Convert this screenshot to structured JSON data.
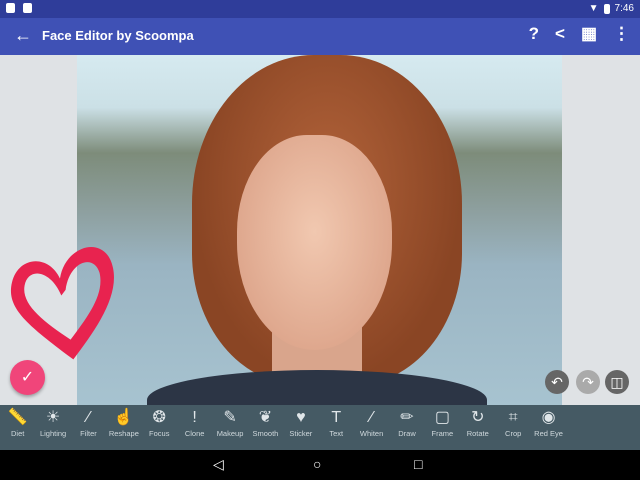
{
  "status": {
    "time": "7:46"
  },
  "appbar": {
    "title": "Face Editor by Scoompa",
    "back_icon": "arrow-left-icon",
    "actions": [
      "help-icon",
      "share-icon",
      "gift-icon",
      "more-vert-icon"
    ]
  },
  "canvas": {
    "sticker": "heart",
    "sticker_color": "#e8234f"
  },
  "controls": {
    "confirm_icon": "check-icon",
    "undo_icon": "undo-icon",
    "redo_icon": "redo-icon",
    "compare_icon": "compare-icon"
  },
  "tools": [
    {
      "label": "Diet",
      "icon": "ruler-icon",
      "glyph": "📏"
    },
    {
      "label": "Lighting",
      "icon": "sun-icon",
      "glyph": "☀"
    },
    {
      "label": "Filter",
      "icon": "magic-wand-icon",
      "glyph": "⁄"
    },
    {
      "label": "Reshape",
      "icon": "hand-icon",
      "glyph": "☝"
    },
    {
      "label": "Focus",
      "icon": "aperture-icon",
      "glyph": "❂"
    },
    {
      "label": "Clone",
      "icon": "exclamation-icon",
      "glyph": "!"
    },
    {
      "label": "Makeup",
      "icon": "lipstick-icon",
      "glyph": "✎"
    },
    {
      "label": "Smooth",
      "icon": "leaf-icon",
      "glyph": "❦"
    },
    {
      "label": "Sticker",
      "icon": "heart-icon",
      "glyph": "♥"
    },
    {
      "label": "Text",
      "icon": "text-icon",
      "glyph": "T"
    },
    {
      "label": "Whiten",
      "icon": "brush-icon",
      "glyph": "⁄"
    },
    {
      "label": "Draw",
      "icon": "pencil-icon",
      "glyph": "✏"
    },
    {
      "label": "Frame",
      "icon": "frame-icon",
      "glyph": "▢"
    },
    {
      "label": "Rotate",
      "icon": "rotate-icon",
      "glyph": "↻"
    },
    {
      "label": "Crop",
      "icon": "crop-icon",
      "glyph": "⌗"
    },
    {
      "label": "Red Eye",
      "icon": "eye-icon",
      "glyph": "◉"
    }
  ],
  "nav": {
    "back": "◁",
    "home": "○",
    "recents": "□"
  }
}
